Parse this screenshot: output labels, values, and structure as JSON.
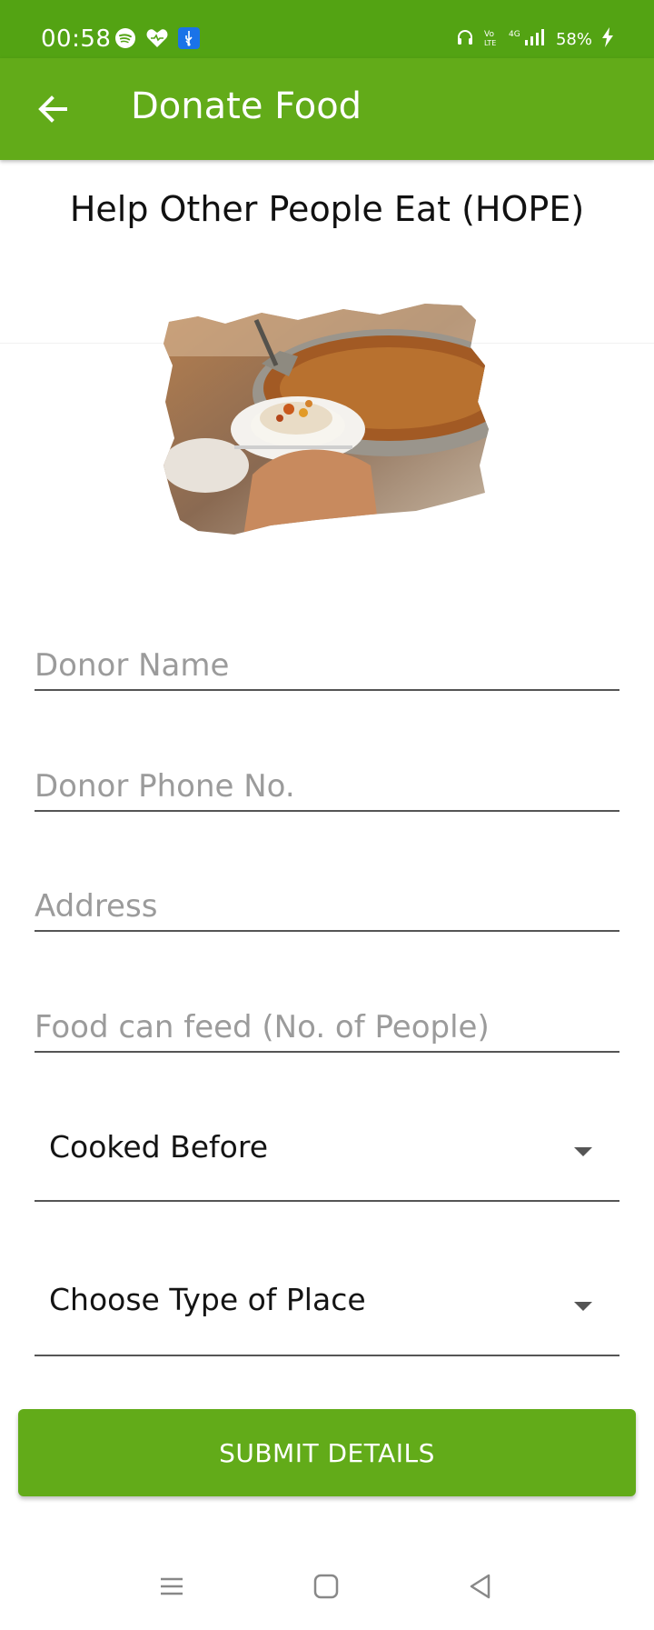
{
  "status_bar": {
    "time": "00:58",
    "battery": "58%",
    "icons": [
      "spotify-icon",
      "heart-icon",
      "usb-icon",
      "headphones-icon",
      "volte-icon",
      "signal-icon",
      "charging-icon"
    ],
    "network": "4G"
  },
  "app_bar": {
    "title": "Donate Food",
    "back_icon": "arrow-left-icon"
  },
  "headline": "Help Other People Eat (HOPE)",
  "form": {
    "donor_name": {
      "placeholder": "Donor Name",
      "value": ""
    },
    "donor_phone": {
      "placeholder": "Donor Phone No.",
      "value": ""
    },
    "address": {
      "placeholder": "Address",
      "value": ""
    },
    "feed_count": {
      "placeholder": "Food can feed (No. of People)",
      "value": ""
    },
    "cooked_before": {
      "selected": "Cooked Before"
    },
    "place_type": {
      "selected": "Choose Type of Place"
    }
  },
  "submit_label": "SUBMIT DETAILS",
  "nav_bar": {
    "icons": [
      "recents-icon",
      "home-icon",
      "back-icon"
    ]
  },
  "colors": {
    "status_bar": "#53a313",
    "primary": "#62ab19",
    "underline": "#555555",
    "placeholder": "#9b9b9b"
  }
}
